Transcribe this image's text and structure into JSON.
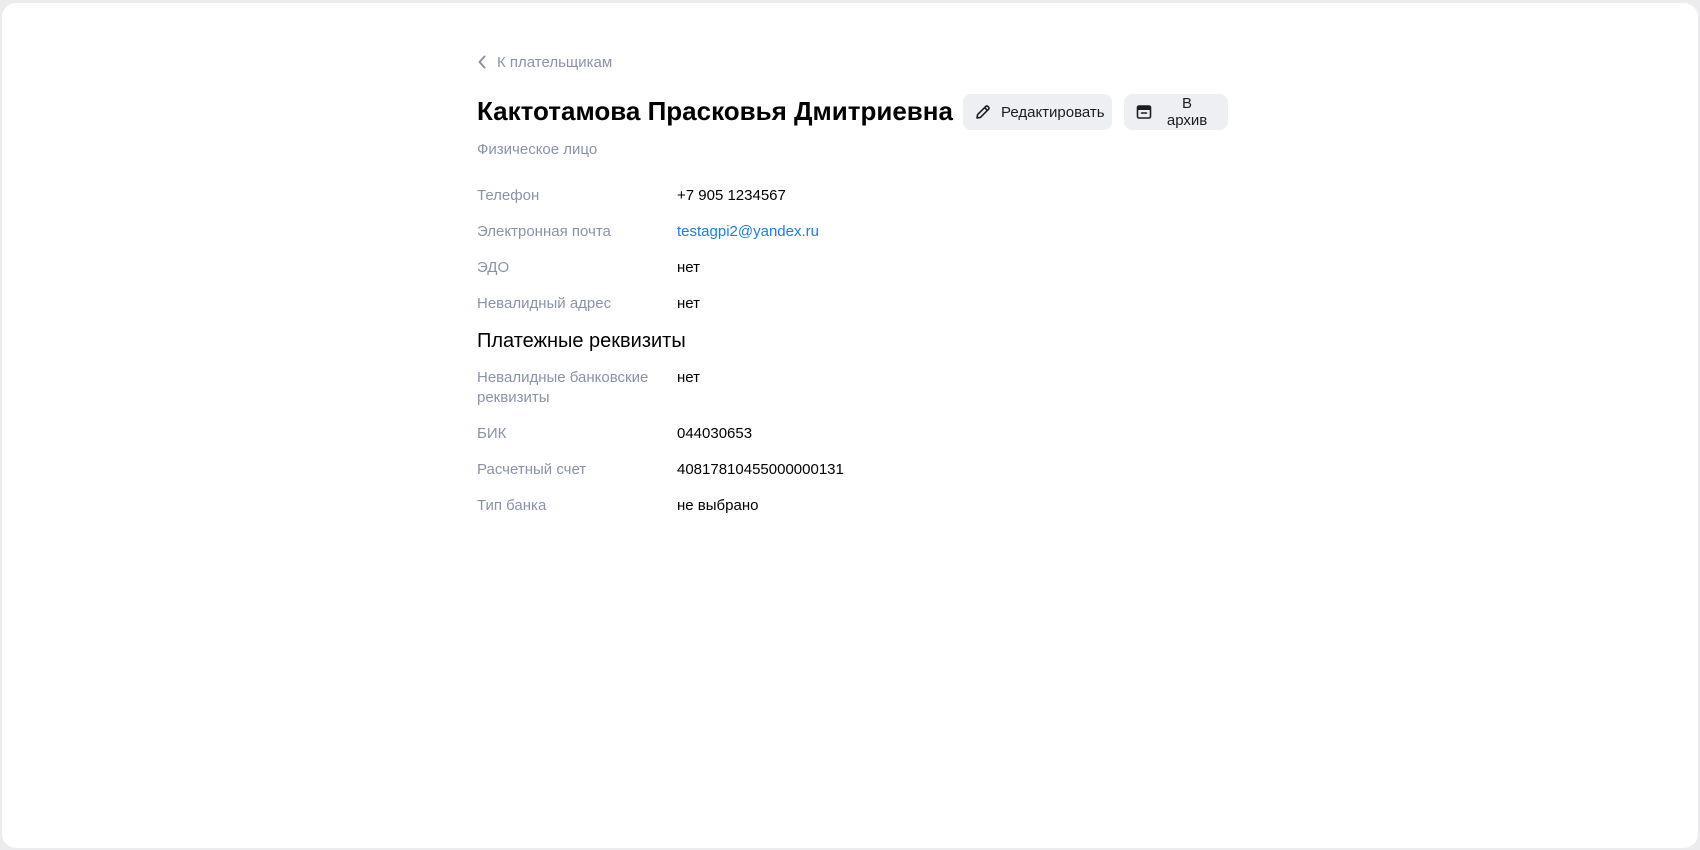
{
  "back_link": {
    "label": "К плательщикам"
  },
  "header": {
    "title": "Кактотамова Прасковья Дмитриевна",
    "subtitle": "Физическое лицо"
  },
  "actions": {
    "edit_label": "Редактировать",
    "archive_label": "В архив"
  },
  "contact_fields": [
    {
      "label": "Телефон",
      "value": "+7 905 1234567"
    },
    {
      "label": "Электронная почта",
      "value": "testagpi2@yandex.ru"
    },
    {
      "label": "ЭДО",
      "value": "нет"
    },
    {
      "label": "Невалидный адрес",
      "value": "нет"
    }
  ],
  "payment_section": {
    "title": "Платежные реквизиты",
    "fields": [
      {
        "label": "Невалидные банковские реквизиты",
        "value": "нет"
      },
      {
        "label": "БИК",
        "value": "044030653"
      },
      {
        "label": "Расчетный счет",
        "value": "40817810455000000131"
      },
      {
        "label": "Тип банка",
        "value": "не выбрано"
      }
    ]
  },
  "colors": {
    "muted_text": "#8a93a6",
    "link": "#1a7fe0",
    "button_bg": "#eeeff3"
  },
  "icons": {
    "back": "chevron-left-icon",
    "edit": "pencil-icon",
    "archive": "archive-box-icon"
  }
}
